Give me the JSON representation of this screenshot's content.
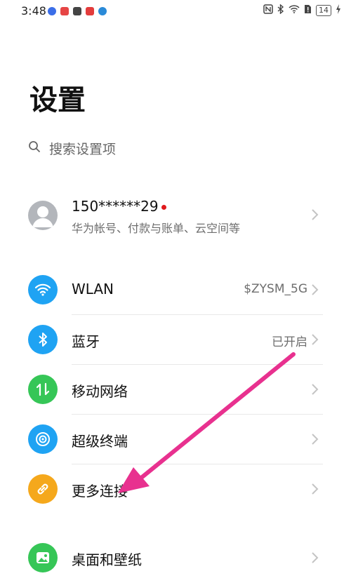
{
  "status_bar": {
    "time": "3:48",
    "battery": "14"
  },
  "page": {
    "title": "设置"
  },
  "search": {
    "placeholder": "搜索设置项"
  },
  "account": {
    "name": "150******29",
    "subtitle": "华为帐号、付款与账单、云空间等"
  },
  "settings": {
    "wlan": {
      "label": "WLAN",
      "value": "$ZYSM_5G",
      "icon": "wifi-icon",
      "color": "#1fa3f3"
    },
    "bluetooth": {
      "label": "蓝牙",
      "value": "已开启",
      "icon": "bluetooth-icon",
      "color": "#1fa3f3"
    },
    "mobile": {
      "label": "移动网络",
      "icon": "mobile-data-icon",
      "color": "#36c657"
    },
    "super": {
      "label": "超级终端",
      "icon": "super-device-icon",
      "color": "#1fa3f3"
    },
    "more": {
      "label": "更多连接",
      "icon": "link-icon",
      "color": "#f5a81c"
    },
    "desktop": {
      "label": "桌面和壁纸",
      "icon": "wallpaper-icon",
      "color": "#36c657"
    }
  },
  "annotation": {
    "arrow_color": "#e8318f"
  }
}
